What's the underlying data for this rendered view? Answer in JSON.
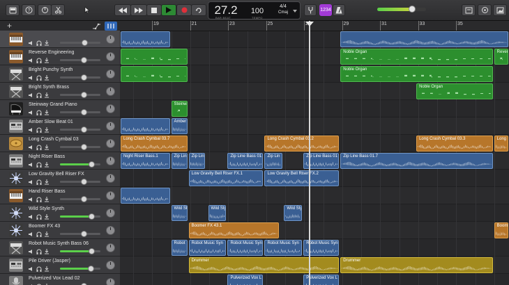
{
  "toolbar": {
    "lcd_position": "27.2",
    "lcd_position_label": "BAR   BEAT",
    "lcd_tempo": "100",
    "lcd_tempo_label": "TEMPO",
    "lcd_signature": "4/4",
    "lcd_key": "Cmaj",
    "count_in": "1234",
    "master_volume": 0.72
  },
  "ruler": [
    "19",
    "21",
    "23",
    "25",
    "27",
    "29",
    "31",
    "33",
    "35"
  ],
  "tracks": [
    {
      "name": "",
      "icon": "synth-keyboard-icon",
      "color": "#8b5a2b",
      "volume": 0.62
    },
    {
      "name": "Reverse Engineering",
      "icon": "synth-keyboard-icon",
      "color": "#8b5a2b",
      "volume": 0.6
    },
    {
      "name": "Bright Punchy Synth",
      "icon": "synth-x-stand-icon",
      "color": "#555",
      "volume": 0.6
    },
    {
      "name": "Bright Synth Brass",
      "icon": "synth-x-stand-icon",
      "color": "#555",
      "volume": 0.6
    },
    {
      "name": "Steinway Grand Piano",
      "icon": "grand-piano-icon",
      "color": "#1e1e1e",
      "volume": 0.6
    },
    {
      "name": "Amber Slow Beat 01",
      "icon": "drum-machine-icon",
      "color": "#7a7a7a",
      "volume": 0.6
    },
    {
      "name": "Long Crash Cymbal 03",
      "icon": "cymbal-icon",
      "color": "#b98a3e",
      "volume": 0.6
    },
    {
      "name": "Night Riser Bass",
      "icon": "drum-machine-icon",
      "color": "#7a7a7a",
      "volume": 0.8
    },
    {
      "name": "Low Gravity Bell Riser FX",
      "icon": "fx-burst-icon",
      "color": "#3a3a3a",
      "volume": 0.6
    },
    {
      "name": "Hand Riser Bass",
      "icon": "synth-keyboard-icon",
      "color": "#8b5a2b",
      "volume": 0.6
    },
    {
      "name": "Wild Style Synth",
      "icon": "fx-burst-icon",
      "color": "#3a3a3a",
      "volume": 0.8
    },
    {
      "name": "Boomer FX 43",
      "icon": "fx-burst-icon",
      "color": "#3a3a3a",
      "volume": 0.6
    },
    {
      "name": "Robot Music Synth Bass 06",
      "icon": "synth-x-stand-icon",
      "color": "#555",
      "volume": 0.8
    },
    {
      "name": "Pile Driver (Jasper)",
      "icon": "drum-machine-icon",
      "color": "#7a7a7a",
      "volume": 0.78
    },
    {
      "name": "Pulverized Vox Lead 02",
      "icon": "microphone-icon",
      "color": "#7a7a7a",
      "volume": 0.6
    }
  ],
  "regions": [
    {
      "lane": 0,
      "start": 0.0,
      "end": 0.13,
      "kind": "blue",
      "name": ""
    },
    {
      "lane": 0,
      "start": 0.565,
      "end": 1.0,
      "kind": "blue",
      "name": ""
    },
    {
      "lane": 1,
      "start": 0.0,
      "end": 0.175,
      "kind": "green",
      "name": ""
    },
    {
      "lane": 1,
      "start": 0.565,
      "end": 0.96,
      "kind": "green",
      "name": "Noble Organ"
    },
    {
      "lane": 1,
      "start": 0.96,
      "end": 1.0,
      "kind": "green",
      "name": "Reverse"
    },
    {
      "lane": 2,
      "start": 0.0,
      "end": 0.175,
      "kind": "green",
      "name": ""
    },
    {
      "lane": 2,
      "start": 0.565,
      "end": 0.96,
      "kind": "green",
      "name": "Noble Organ"
    },
    {
      "lane": 3,
      "start": 0.76,
      "end": 0.96,
      "kind": "green",
      "name": "Noble Organ"
    },
    {
      "lane": 4,
      "start": 0.13,
      "end": 0.175,
      "kind": "green",
      "name": "Steinway"
    },
    {
      "lane": 5,
      "start": 0.0,
      "end": 0.13,
      "kind": "blue",
      "name": ""
    },
    {
      "lane": 5,
      "start": 0.13,
      "end": 0.175,
      "kind": "blue",
      "name": "Amber"
    },
    {
      "lane": 6,
      "start": 0.0,
      "end": 0.175,
      "kind": "orange",
      "name": "Long Crash Cymbal 03.7"
    },
    {
      "lane": 6,
      "start": 0.37,
      "end": 0.565,
      "kind": "orange",
      "name": "Long Crash Cymbal 03.2"
    },
    {
      "lane": 6,
      "start": 0.76,
      "end": 0.96,
      "kind": "orange",
      "name": "Long Crash Cymbal 03.3"
    },
    {
      "lane": 6,
      "start": 0.96,
      "end": 1.0,
      "kind": "orange",
      "name": "Long"
    },
    {
      "lane": 7,
      "start": 0.0,
      "end": 0.13,
      "kind": "blue",
      "name": "Night Riser Bass.1"
    },
    {
      "lane": 7,
      "start": 0.13,
      "end": 0.175,
      "kind": "blue",
      "name": "Zip Lin"
    },
    {
      "lane": 7,
      "start": 0.175,
      "end": 0.22,
      "kind": "blue",
      "name": "Zip Lin"
    },
    {
      "lane": 7,
      "start": 0.275,
      "end": 0.37,
      "kind": "blue",
      "name": "Zip Line Bass 01."
    },
    {
      "lane": 7,
      "start": 0.37,
      "end": 0.42,
      "kind": "blue",
      "name": "Zip Lin"
    },
    {
      "lane": 7,
      "start": 0.47,
      "end": 0.565,
      "kind": "blue",
      "name": "Zip Line Bass 01"
    },
    {
      "lane": 7,
      "start": 0.565,
      "end": 0.96,
      "kind": "blue",
      "name": "Zip Line Bass 01.7"
    },
    {
      "lane": 8,
      "start": 0.175,
      "end": 0.37,
      "kind": "blue",
      "name": "Low Gravity Bell Riser FX.1"
    },
    {
      "lane": 8,
      "start": 0.37,
      "end": 0.565,
      "kind": "blue",
      "name": "Low Gravity Bell Riser FX.2"
    },
    {
      "lane": 9,
      "start": 0.0,
      "end": 0.13,
      "kind": "blue",
      "name": ""
    },
    {
      "lane": 10,
      "start": 0.13,
      "end": 0.175,
      "kind": "blue",
      "name": "Wild Styl"
    },
    {
      "lane": 10,
      "start": 0.225,
      "end": 0.275,
      "kind": "blue",
      "name": "Wild Styl"
    },
    {
      "lane": 10,
      "start": 0.42,
      "end": 0.47,
      "kind": "blue",
      "name": "Wild Styl"
    },
    {
      "lane": 11,
      "start": 0.175,
      "end": 0.41,
      "kind": "orange",
      "name": "Boomer FX 43.1"
    },
    {
      "lane": 11,
      "start": 0.96,
      "end": 1.0,
      "kind": "orange",
      "name": "Boome"
    },
    {
      "lane": 12,
      "start": 0.13,
      "end": 0.175,
      "kind": "blue",
      "name": "Robot"
    },
    {
      "lane": 12,
      "start": 0.175,
      "end": 0.275,
      "kind": "blue",
      "name": "Robot Music Syn"
    },
    {
      "lane": 12,
      "start": 0.275,
      "end": 0.37,
      "kind": "blue",
      "name": "Robot Music Syn"
    },
    {
      "lane": 12,
      "start": 0.37,
      "end": 0.47,
      "kind": "blue",
      "name": "Robot Music Syn"
    },
    {
      "lane": 12,
      "start": 0.47,
      "end": 0.565,
      "kind": "blue",
      "name": "Robot Music Syn"
    },
    {
      "lane": 13,
      "start": 0.175,
      "end": 0.565,
      "kind": "gold",
      "name": "Drummer"
    },
    {
      "lane": 13,
      "start": 0.565,
      "end": 0.96,
      "kind": "gold",
      "name": "Drummer"
    },
    {
      "lane": 14,
      "start": 0.275,
      "end": 0.37,
      "kind": "blue",
      "name": "Pulverized Vox L"
    },
    {
      "lane": 14,
      "start": 0.47,
      "end": 0.565,
      "kind": "blue",
      "name": "Pulverized Vox L"
    }
  ]
}
